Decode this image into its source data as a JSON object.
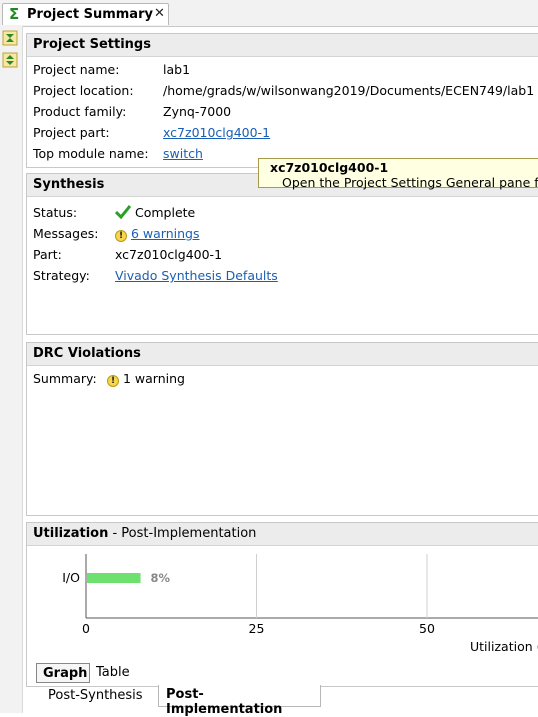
{
  "tab": {
    "title": "Project Summary",
    "close": "✕"
  },
  "project_settings": {
    "header": "Project Settings",
    "rows": [
      {
        "label": "Project name:",
        "value": "lab1"
      },
      {
        "label": "Project location:",
        "value": "/home/grads/w/wilsonwang2019/Documents/ECEN749/lab1"
      },
      {
        "label": "Product family:",
        "value": "Zynq-7000"
      },
      {
        "label": "Project part:",
        "value": "xc7z010clg400-1"
      },
      {
        "label": "Top module name:",
        "value": "switch"
      }
    ]
  },
  "tooltip": {
    "title": "xc7z010clg400-1",
    "text": "Open the Project Settings General pane f"
  },
  "synthesis": {
    "header": "Synthesis",
    "status_label": "Status:",
    "status_value": "Complete",
    "messages_label": "Messages:",
    "messages_value": "6 warnings",
    "part_label": "Part:",
    "part_value": "xc7z010clg400-1",
    "strategy_label": "Strategy:",
    "strategy_value": "Vivado Synthesis Defaults"
  },
  "drc": {
    "header": "DRC Violations",
    "summary_label": "Summary:",
    "summary_value": "1 warning"
  },
  "utilization": {
    "header": "Utilization",
    "subheader": " - Post-Implementation",
    "view_tabs": [
      "Graph",
      "Table"
    ],
    "stage_tabs": [
      "Post-Synthesis",
      "Post-Implementation"
    ],
    "axis_label": "Utilization ("
  },
  "chart_data": {
    "type": "bar",
    "orientation": "horizontal",
    "categories": [
      "I/O"
    ],
    "values": [
      8
    ],
    "value_labels": [
      "8%"
    ],
    "xlabel": "Utilization (",
    "xticks": [
      0,
      25,
      50
    ],
    "xlim": [
      0,
      75
    ],
    "grid": true,
    "bar_color": "#6ee06e"
  }
}
